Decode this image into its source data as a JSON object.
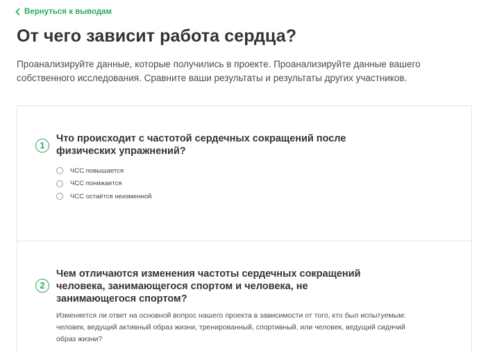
{
  "nav": {
    "back_label": "Вернуться к выводам"
  },
  "header": {
    "title": "От чего зависит работа сердца?",
    "intro": "Проанализируйте данные, которые получились в проекте. Проанализируйте данные вашего собственного исследования. Сравните ваши результаты и результаты других участников."
  },
  "questions": [
    {
      "number": "1",
      "title": "Что происходит с частотой сердечных сокращений после физических упражнений?",
      "options": [
        "ЧСС повышается",
        "ЧСС понижается",
        "ЧСС остаётся неизменной"
      ]
    },
    {
      "number": "2",
      "title": "Чем отличаются изменения частоты сердечных сокращений человека, занимающегося спортом и человека, не занимающегося спортом?",
      "description": "Изменяется ли ответ на основной вопрос нашего проекта в зависимости от того, кто был испытуемым: человек, ведущий активный образ жизни, тренированный, спортивный, или человек, ведущий сидячий образ жизни?"
    }
  ],
  "colors": {
    "accent": "#2bab5c",
    "text": "#333333",
    "border": "#e3e3e3"
  }
}
